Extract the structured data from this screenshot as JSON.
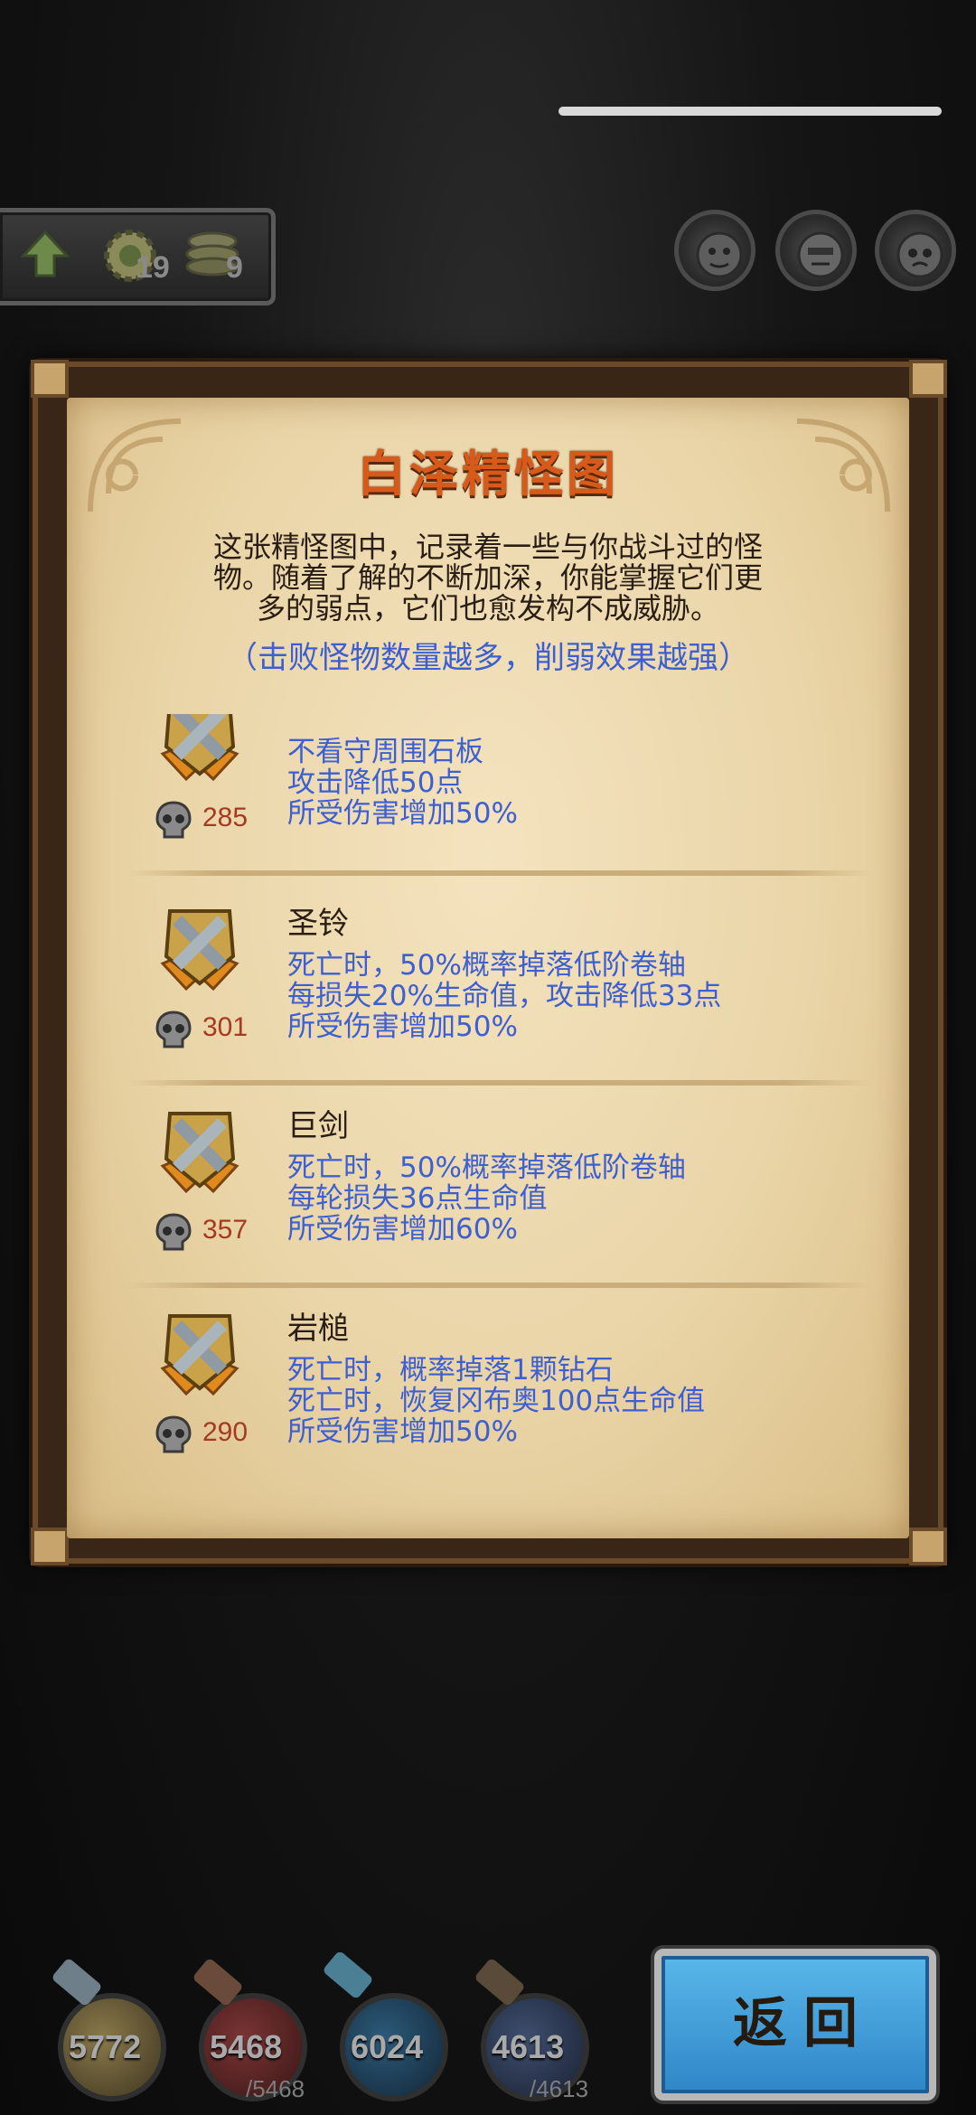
{
  "top_resources": {
    "gear_count": "19",
    "coin_count": "9"
  },
  "panel": {
    "title": "白泽精怪图",
    "intro_lines": [
      "这张精怪图中，记录着一些与你战斗过的怪",
      "物。随着了解的不断加深，你能掌握它们更",
      "多的弱点，它们也愈发构不成威胁。"
    ],
    "hint": "（击败怪物数量越多，削弱效果越强）"
  },
  "entries": [
    {
      "name": "",
      "kills": "285",
      "lines": [
        "不看守周围石板",
        "攻击降低50点",
        "所受伤害增加50%"
      ]
    },
    {
      "name": "圣铃",
      "kills": "301",
      "lines": [
        "死亡时，50%概率掉落低阶卷轴",
        "每损失20%生命值，攻击降低33点",
        "所受伤害增加50%"
      ]
    },
    {
      "name": "巨剑",
      "kills": "357",
      "lines": [
        "死亡时，50%概率掉落低阶卷轴",
        "每轮损失36点生命值",
        "所受伤害增加60%"
      ]
    },
    {
      "name": "岩槌",
      "kills": "290",
      "lines": [
        "死亡时，概率掉落1颗钻石",
        "死亡时，恢复冈布奥100点生命值",
        "所受伤害增加50%"
      ]
    }
  ],
  "bottom_stats": {
    "attack": "5772",
    "hp": "5468",
    "hp_max": "/5468",
    "defense": "6024",
    "mp": "4613",
    "mp_max": "/4613"
  },
  "back_button": {
    "label": "返回"
  },
  "colors": {
    "title": "#d85a1b",
    "effect_text": "#3d5fd1",
    "kills_text": "#a53a22",
    "parchment": "#ead5a8",
    "back_button": "#3f9ad8"
  }
}
